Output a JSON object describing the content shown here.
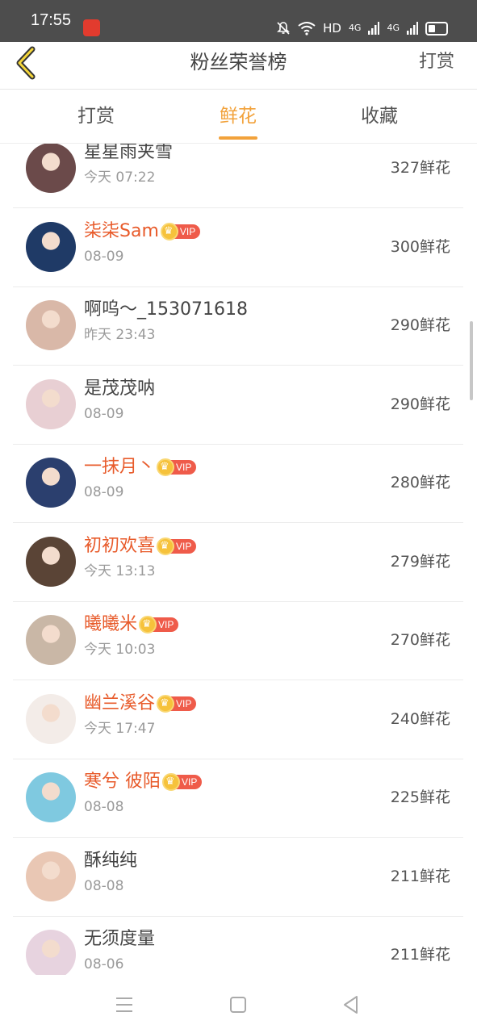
{
  "status_bar": {
    "time": "17:55",
    "network_label": "HD",
    "sim1_label": "4G",
    "sim2_label": "4G"
  },
  "header": {
    "title": "粉丝荣誉榜",
    "action_label": "打赏"
  },
  "tabs": [
    {
      "label": "打赏",
      "active": false
    },
    {
      "label": "鲜花",
      "active": true
    },
    {
      "label": "收藏",
      "active": false
    }
  ],
  "vip_label": "VIP",
  "fans": [
    {
      "name": "星星雨夹雪",
      "time": "今天 07:22",
      "count": "327鲜花",
      "vip": false
    },
    {
      "name": "柒柒Sam",
      "time": "08-09",
      "count": "300鲜花",
      "vip": true
    },
    {
      "name": "啊呜～_153071618",
      "time": "昨天 23:43",
      "count": "290鲜花",
      "vip": false
    },
    {
      "name": "是茂茂呐",
      "time": "08-09",
      "count": "290鲜花",
      "vip": false
    },
    {
      "name": "一抹月丶",
      "time": "08-09",
      "count": "280鲜花",
      "vip": true
    },
    {
      "name": "初初欢喜",
      "time": "今天 13:13",
      "count": "279鲜花",
      "vip": true
    },
    {
      "name": "曦曦米",
      "time": "今天 10:03",
      "count": "270鲜花",
      "vip": true
    },
    {
      "name": "幽兰溪谷",
      "time": "今天 17:47",
      "count": "240鲜花",
      "vip": true
    },
    {
      "name": "寒兮 彼陌",
      "time": "08-08",
      "count": "225鲜花",
      "vip": true
    },
    {
      "name": "酥纯纯",
      "time": "08-08",
      "count": "211鲜花",
      "vip": false
    },
    {
      "name": "无须度量",
      "time": "08-06",
      "count": "211鲜花",
      "vip": false
    }
  ],
  "colors": {
    "accent": "#f2a23b",
    "vip_name": "#e85b2b",
    "vip_badge": "#ef5b4a",
    "status_bar": "#4d4d4d"
  },
  "icons": [
    "back-chevron-icon",
    "mute-bell-icon",
    "wifi-icon",
    "signal-icon",
    "battery-icon",
    "menu-icon",
    "home-square-icon",
    "back-triangle-icon"
  ]
}
